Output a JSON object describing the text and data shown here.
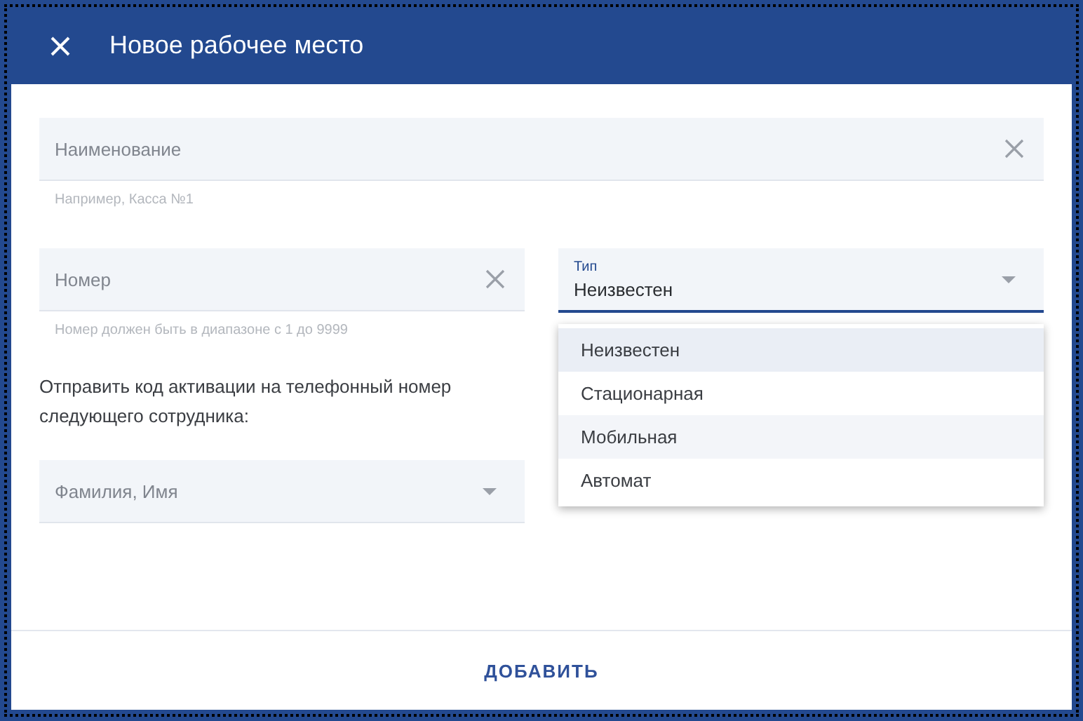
{
  "dialog": {
    "title": "Новое рабочее место"
  },
  "name_field": {
    "placeholder": "Наименование",
    "hint": "Например, Касса №1"
  },
  "number_field": {
    "placeholder": "Номер",
    "hint": "Номер должен быть в диапазоне с 1 до 9999"
  },
  "type_field": {
    "label": "Тип",
    "value": "Неизвестен",
    "expanded": true,
    "options": [
      {
        "label": "Неизвестен",
        "selected": true,
        "hovered": false
      },
      {
        "label": "Стационарная",
        "selected": false,
        "hovered": false
      },
      {
        "label": "Мобильная",
        "selected": false,
        "hovered": true
      },
      {
        "label": "Автомат",
        "selected": false,
        "hovered": false
      }
    ]
  },
  "activation_text": "Отправить код активации на телефонный номер следующего сотрудника:",
  "employee_field": {
    "placeholder": "Фамилия, Имя"
  },
  "buttons": [
    "ДОБАВИТЬ"
  ]
}
